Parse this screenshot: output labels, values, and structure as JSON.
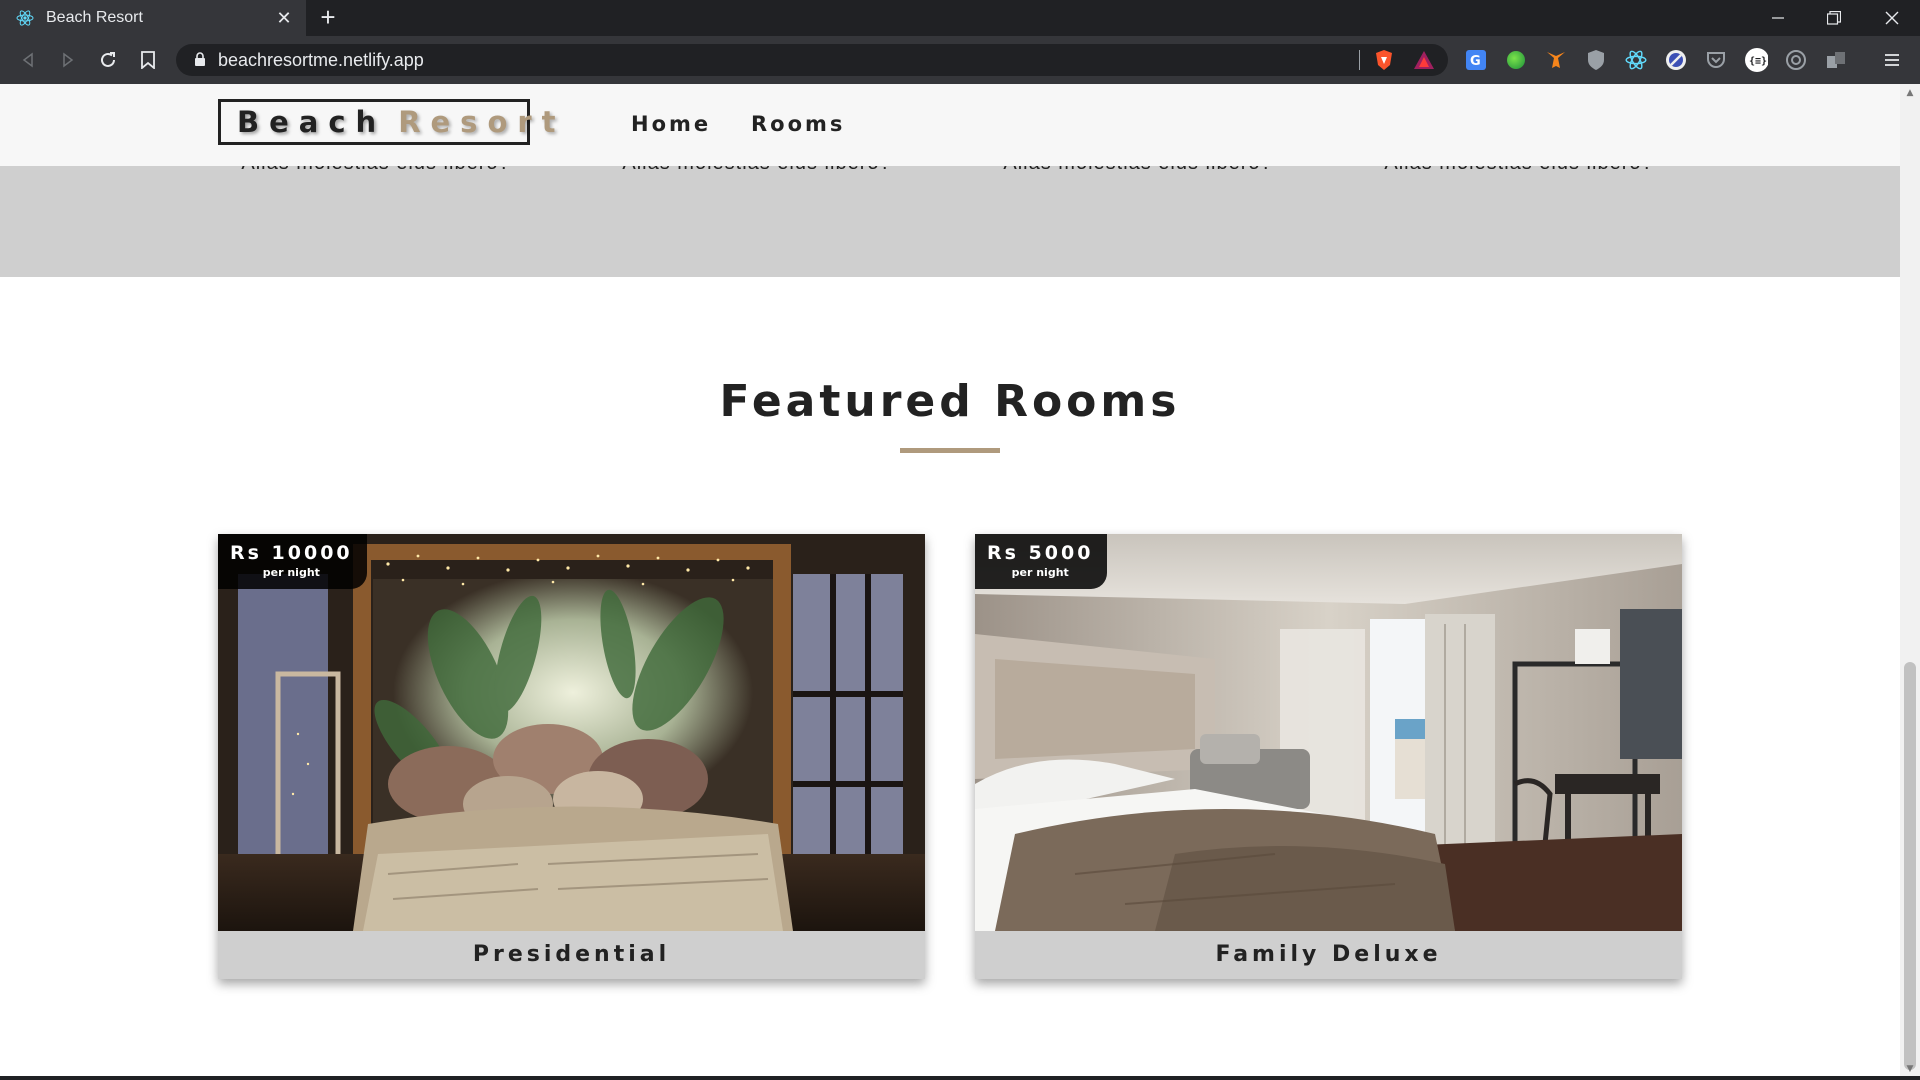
{
  "browser": {
    "tab_title": "Beach Resort",
    "tab_close": "✕",
    "new_tab": "+",
    "url": "beachresortme.netlify.app"
  },
  "site": {
    "logo_part1": "Beach",
    "logo_part2": "Resort",
    "nav": [
      "Home",
      "Rooms"
    ]
  },
  "services": {
    "items": [
      "Alias molestias eius libero?",
      "Alias molestias eius libero?",
      "Alias molestias eius libero?",
      "Alias molestias eius libero?"
    ]
  },
  "featured": {
    "title": "Featured Rooms",
    "rooms": [
      {
        "name": "Presidential",
        "price": "Rs 10000",
        "per": "per night"
      },
      {
        "name": "Family Deluxe",
        "price": "Rs 5000",
        "per": "per night"
      }
    ]
  },
  "colors": {
    "accent": "#af9a7d",
    "strip": "#cfcfcf",
    "navbar": "#f7f7f7",
    "text": "#222222"
  }
}
